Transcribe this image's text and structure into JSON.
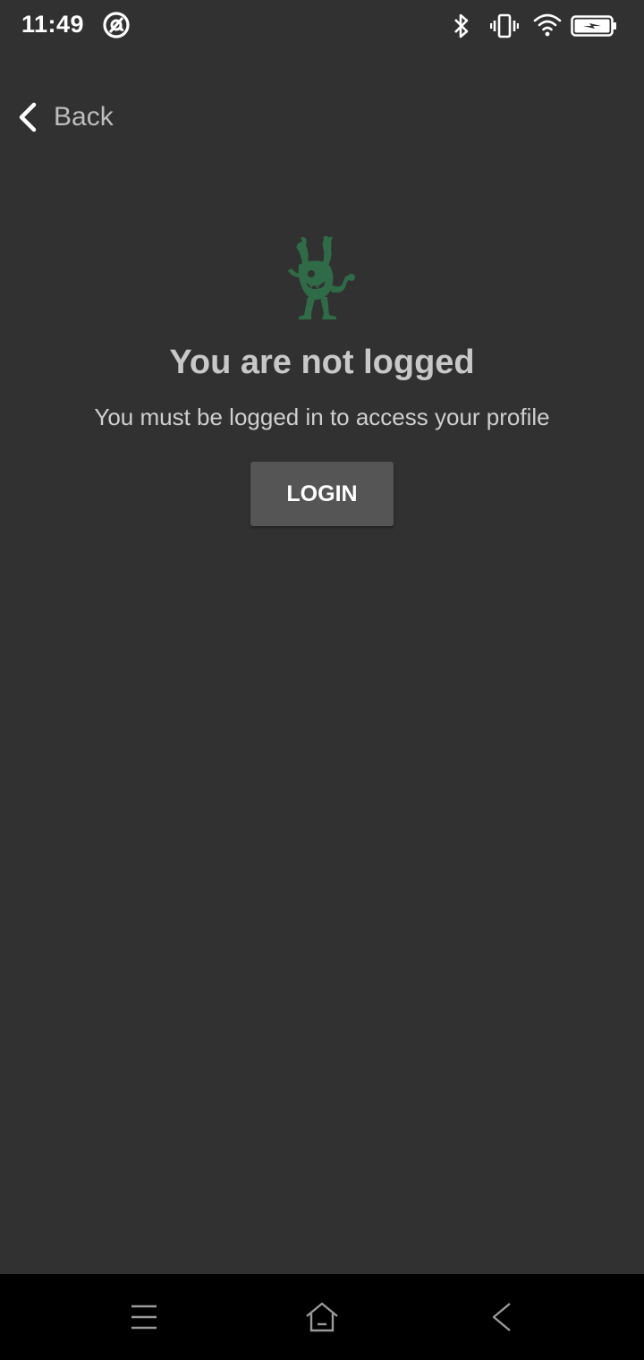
{
  "status_bar": {
    "time": "11:49",
    "icons": [
      "at-sign-icon",
      "bluetooth-icon",
      "vibrate-icon",
      "wifi-icon",
      "battery-charging-icon"
    ]
  },
  "header": {
    "back_label": "Back"
  },
  "main": {
    "mascot_icon": "monster-mascot-icon",
    "mascot_color": "#2f6b47",
    "title": "You are not logged",
    "subtitle": "You must be logged in to access your profile",
    "login_label": "LOGIN"
  },
  "nav_bar": {
    "items": [
      "menu-icon",
      "home-icon",
      "back-icon"
    ]
  },
  "colors": {
    "background": "#313131",
    "button": "#555556",
    "nav_bar": "#000000"
  }
}
